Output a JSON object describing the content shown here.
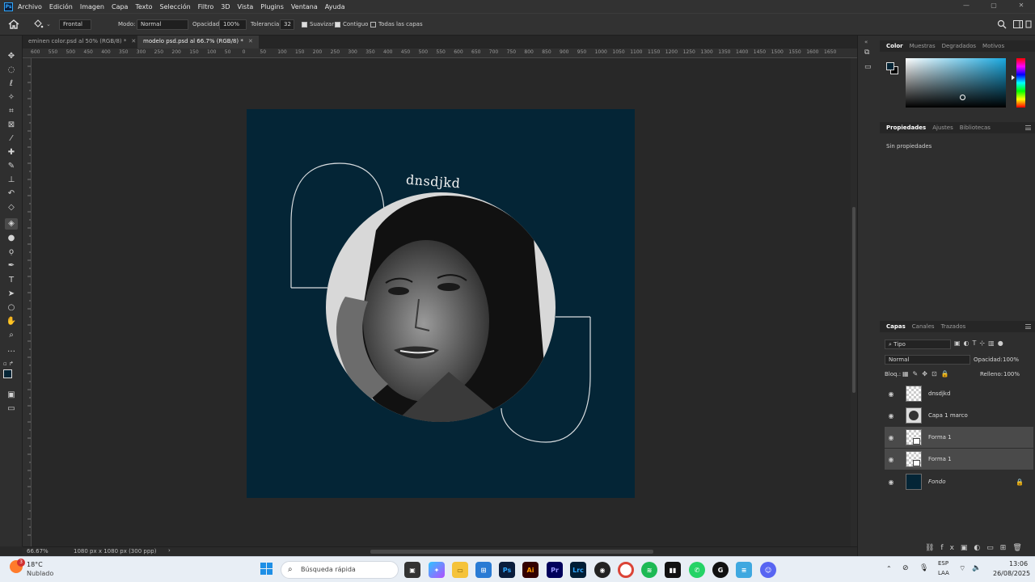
{
  "menu": {
    "app_icon": "Ps",
    "items": [
      "Archivo",
      "Edición",
      "Imagen",
      "Capa",
      "Texto",
      "Selección",
      "Filtro",
      "3D",
      "Vista",
      "Plugins",
      "Ventana",
      "Ayuda"
    ]
  },
  "window_controls": {
    "minimize": "—",
    "maximize": "▢",
    "close": "✕"
  },
  "options": {
    "home_icon": "home-icon",
    "tool_icon": "paint-bucket-icon",
    "fill_source": "Frontal",
    "mode_label": "Modo:",
    "mode_value": "Normal",
    "opacity_label": "Opacidad:",
    "opacity_value": "100%",
    "tolerance_label": "Tolerancia:",
    "tolerance_value": "32",
    "antialias_label": "Suavizar",
    "contiguous_label": "Contiguo",
    "all_layers_label": "Todas las capas"
  },
  "tabs": [
    {
      "label": "eminen color.psd al 50% (RGB/8) *",
      "active": false
    },
    {
      "label": "modelo psd.psd al 66.7% (RGB/8) *",
      "active": true
    }
  ],
  "ruler": {
    "h_labels": [
      "600",
      "550",
      "500",
      "450",
      "400",
      "350",
      "300",
      "250",
      "200",
      "150",
      "100",
      "50",
      "0",
      "50",
      "100",
      "150",
      "200",
      "250",
      "300",
      "350",
      "400",
      "450",
      "500",
      "550",
      "600",
      "650",
      "700",
      "750",
      "800",
      "850",
      "900",
      "950",
      "1000",
      "1050",
      "1100",
      "1150",
      "1200",
      "1250",
      "1300",
      "1350",
      "1400",
      "1450",
      "1500",
      "1550",
      "1600",
      "1650"
    ]
  },
  "canvas": {
    "artboard_text": "dnsdjkd",
    "background_color": "#042536"
  },
  "status": {
    "zoom": "66.67%",
    "doc_info": "1080 px x 1080 px (300 ppp)",
    "arrow": "›"
  },
  "color_panel": {
    "tabs": [
      "Color",
      "Muestras",
      "Degradados",
      "Motivos"
    ],
    "active_tab": "Color",
    "hue_color": "#1aa9e0",
    "foreground": "#042536",
    "background": "#000000"
  },
  "properties_panel": {
    "tabs": [
      "Propiedades",
      "Ajustes",
      "Bibliotecas"
    ],
    "active_tab": "Propiedades",
    "text": "Sin propiedades"
  },
  "layers_panel": {
    "tabs": [
      "Capas",
      "Canales",
      "Trazados"
    ],
    "active_tab": "Capas",
    "filter_label": "Tipo",
    "blend_mode": "Normal",
    "opacity_label": "Opacidad:",
    "opacity_value": "100%",
    "lock_label": "Bloq.:",
    "fill_label": "Relleno:",
    "fill_value": "100%",
    "layers": [
      {
        "name": "dnsdjkd",
        "kind": "text",
        "selected": false
      },
      {
        "name": "Capa 1 marco",
        "kind": "photo",
        "selected": false
      },
      {
        "name": "Forma 1",
        "kind": "shape",
        "selected": true
      },
      {
        "name": "Forma 1",
        "kind": "shape",
        "selected": true
      },
      {
        "name": "Fondo",
        "kind": "background",
        "selected": false
      }
    ]
  },
  "taskbar": {
    "weather_temp": "18°C",
    "weather_desc": "Nublado",
    "weather_badge": "3",
    "search_placeholder": "Búsqueda rápida",
    "apps": [
      {
        "name": "ps",
        "label": "Ps",
        "color": "#0a1d3c"
      },
      {
        "name": "ai",
        "label": "Ai",
        "color": "#2b0c00"
      },
      {
        "name": "pr",
        "label": "Pr",
        "color": "#1a0a3a"
      },
      {
        "name": "lrc",
        "label": "Lrc",
        "color": "#0b1f33"
      }
    ],
    "lang": "ESP",
    "lang_sub": "LAA",
    "time": "13:06",
    "date": "26/08/2025"
  }
}
